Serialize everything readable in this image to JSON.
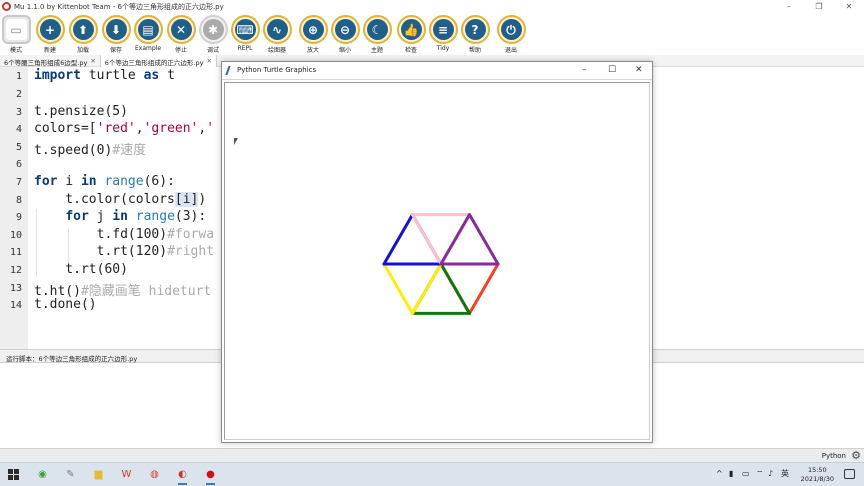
{
  "window": {
    "title": "Mu 1.1.0 by Kittenbot Team - 6个等边三角形组成的正六边形.py",
    "minimize": "–",
    "maximize": "❐",
    "close": "✕"
  },
  "toolbar": {
    "items": [
      {
        "label": "模式",
        "glyph": "▭",
        "icon": "mode-icon"
      },
      {
        "label": "新建",
        "glyph": "+",
        "icon": "plus-icon"
      },
      {
        "label": "加载",
        "glyph": "⬆",
        "icon": "upload-icon"
      },
      {
        "label": "保存",
        "glyph": "⬇",
        "icon": "download-icon"
      },
      {
        "label": "Example",
        "glyph": "▤",
        "icon": "example-icon"
      },
      {
        "label": "停止",
        "glyph": "✕",
        "icon": "stop-icon"
      },
      {
        "label": "调试",
        "glyph": "✱",
        "icon": "bug-icon"
      },
      {
        "label": "REPL",
        "glyph": "⌨",
        "icon": "keyboard-icon"
      },
      {
        "label": "绘图器",
        "glyph": "∿",
        "icon": "pulse-icon"
      },
      {
        "label": "放大",
        "glyph": "⊕",
        "icon": "zoom-in-icon"
      },
      {
        "label": "缩小",
        "glyph": "⊖",
        "icon": "zoom-out-icon"
      },
      {
        "label": "主题",
        "glyph": "☾",
        "icon": "moon-icon"
      },
      {
        "label": "检查",
        "glyph": "👍",
        "icon": "thumbs-up-icon"
      },
      {
        "label": "Tidy",
        "glyph": "≡",
        "icon": "tidy-icon"
      },
      {
        "label": "帮助",
        "glyph": "?",
        "icon": "help-icon"
      },
      {
        "label": "退出",
        "glyph": "⏻",
        "icon": "power-icon"
      }
    ]
  },
  "tabs": [
    {
      "label": "6个等腰三角形组成6边型.py",
      "close": "✕"
    },
    {
      "label": "6个等边三角形组成的正六边形.py",
      "close": "✕"
    }
  ],
  "editor": {
    "line_numbers": [
      "1",
      "2",
      "3",
      "4",
      "5",
      "6",
      "7",
      "8",
      "9",
      "10",
      "11",
      "12",
      "13",
      "14"
    ],
    "code": {
      "l1_kw1": "import",
      "l1_mid": " turtle ",
      "l1_kw2": "as",
      "l1_end": " t",
      "l3": "t.pensize(5)",
      "l4_a": "colors=[",
      "l4_s1": "'red'",
      "l4_c1": ",",
      "l4_s2": "'green'",
      "l4_c2": ",",
      "l4_s3": "'",
      "l5_a": "t.speed(0)",
      "l5_cmt": "#速度",
      "l7_kw1": "for",
      "l7_mid": " i ",
      "l7_kw2": "in",
      "l7_sp": " ",
      "l7_fn": "range",
      "l7_end": "(6):",
      "l8_a": "    t.color(colors",
      "l8_hl": "[i]",
      "l8_end": ")",
      "l9_sp": "    ",
      "l9_kw1": "for",
      "l9_mid": " j ",
      "l9_kw2": "in",
      "l9_sp2": " ",
      "l9_fn": "range",
      "l9_end": "(3):",
      "l10_a": "        t.fd(100)",
      "l10_cmt": "#forwa",
      "l11_a": "        t.rt(120)",
      "l11_cmt": "#right",
      "l12": "    t.rt(60)",
      "l13_a": "t.ht()",
      "l13_cmt": "#隐藏画笔 hideturt",
      "l14": "t.done()"
    }
  },
  "run_panel": {
    "text": "运行脚本：6个等边三角形组成的正六边形.py"
  },
  "statusbar": {
    "mode": "Python",
    "gear_icon": "gear-icon"
  },
  "turtle_window": {
    "title": "Python Turtle Graphics",
    "minimize": "–",
    "maximize": "☐",
    "close": "✕"
  },
  "drawing": {
    "colors": [
      "red",
      "green",
      "yellow",
      "blue",
      "pink",
      "purple"
    ],
    "pen_size": 5,
    "side": 100,
    "color_hex": {
      "red": "#ff3b1f",
      "green": "#0a7a0a",
      "yellow": "#ffee00",
      "blue": "#1010e0",
      "pink": "#ffc0cb",
      "purple": "#8a2a9a"
    }
  },
  "taskbar": {
    "apps": [
      {
        "icon": "browser-360-icon",
        "glyph": "◉",
        "color": "#3aa03a"
      },
      {
        "icon": "feather-app-icon",
        "glyph": "✎",
        "color": "#777777"
      },
      {
        "icon": "folder-icon",
        "glyph": "▆",
        "color": "#e8b830"
      },
      {
        "icon": "wps-icon",
        "glyph": "W",
        "color": "#d03a2a"
      },
      {
        "icon": "chrome-icon",
        "glyph": "◍",
        "color": "#d04a2a"
      },
      {
        "icon": "mu-editor-icon",
        "glyph": "◐",
        "color": "#c0392b"
      },
      {
        "icon": "record-icon",
        "glyph": "●",
        "color": "#d01010"
      }
    ],
    "tray": {
      "chevron": "^",
      "ime": "英"
    },
    "time": "15:50",
    "date": "2021/8/30"
  }
}
